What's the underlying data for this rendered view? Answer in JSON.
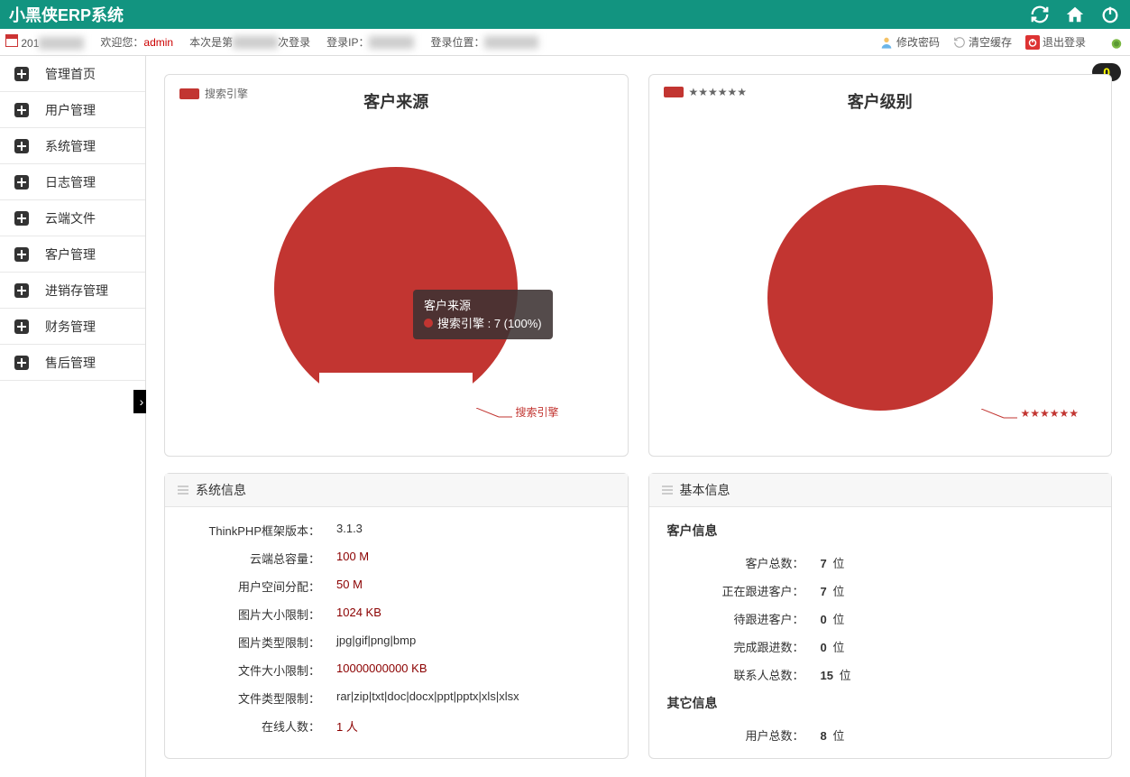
{
  "app_title": "小黑侠ERP系统",
  "status": {
    "date_prefix": "201",
    "welcome": "欢迎您：",
    "user": "admin",
    "login_count_prefix": "本次是第",
    "login_count_suffix": "次登录",
    "login_ip_label": "登录IP：",
    "login_loc_label": "登录位置：",
    "change_pwd": "修改密码",
    "clear_cache": "清空缓存",
    "logout": "退出登录"
  },
  "sidebar": {
    "items": [
      {
        "label": "管理首页"
      },
      {
        "label": "用户管理"
      },
      {
        "label": "系统管理"
      },
      {
        "label": "日志管理"
      },
      {
        "label": "云端文件"
      },
      {
        "label": "客户管理"
      },
      {
        "label": "进销存管理"
      },
      {
        "label": "财务管理"
      },
      {
        "label": "售后管理"
      }
    ]
  },
  "badge": "0",
  "chart_data": [
    {
      "type": "pie",
      "title": "客户来源",
      "series": [
        {
          "name": "搜索引擎",
          "value": 7,
          "percent": 100
        }
      ],
      "legend": [
        "搜索引擎"
      ],
      "tooltip_title": "客户来源",
      "tooltip_line": "搜索引擎 : 7 (100%)",
      "slice_label": "搜索引擎"
    },
    {
      "type": "pie",
      "title": "客户级别",
      "series": [
        {
          "name": "★★★★★★",
          "value": 7,
          "percent": 100
        }
      ],
      "legend": [
        "★★★★★★"
      ],
      "slice_label": "★★★★★★"
    }
  ],
  "sysinfo": {
    "title": "系统信息",
    "rows": [
      {
        "label": "ThinkPHP框架版本：",
        "value": "3.1.3",
        "red": false
      },
      {
        "label": "云端总容量：",
        "value": "100 M",
        "red": true
      },
      {
        "label": "用户空间分配：",
        "value": "50 M",
        "red": true
      },
      {
        "label": "图片大小限制：",
        "value": "1024 KB",
        "red": true
      },
      {
        "label": "图片类型限制：",
        "value": "jpg|gif|png|bmp",
        "red": false
      },
      {
        "label": "文件大小限制：",
        "value": "10000000000 KB",
        "red": true
      },
      {
        "label": "文件类型限制：",
        "value": "rar|zip|txt|doc|docx|ppt|pptx|xls|xlsx",
        "red": false
      },
      {
        "label": "在线人数：",
        "value": "1 人",
        "red": true
      }
    ]
  },
  "basicinfo": {
    "title": "基本信息",
    "section1_title": "客户信息",
    "section1": [
      {
        "label": "客户总数：",
        "value": "7",
        "unit": "位"
      },
      {
        "label": "正在跟进客户：",
        "value": "7",
        "unit": "位"
      },
      {
        "label": "待跟进客户：",
        "value": "0",
        "unit": "位"
      },
      {
        "label": "完成跟进数：",
        "value": "0",
        "unit": "位"
      },
      {
        "label": "联系人总数：",
        "value": "15",
        "unit": "位"
      }
    ],
    "section2_title": "其它信息",
    "section2": [
      {
        "label": "用户总数：",
        "value": "8",
        "unit": "位"
      }
    ]
  }
}
